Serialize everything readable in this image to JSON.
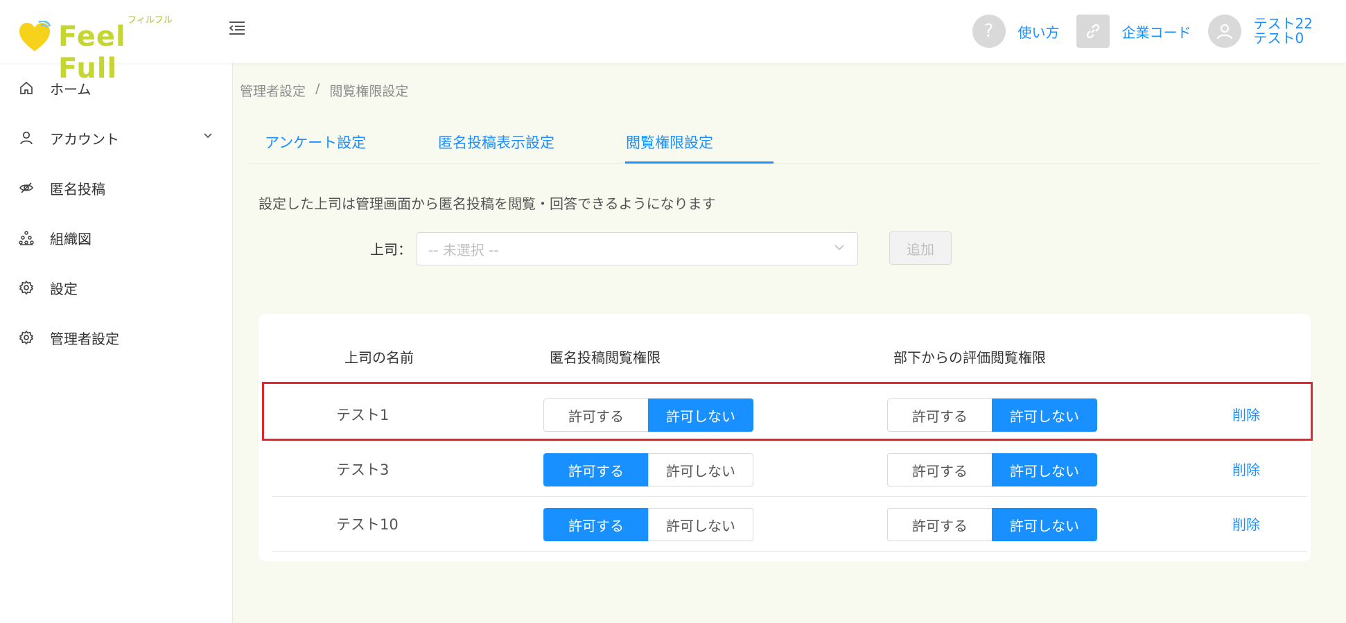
{
  "header": {
    "brand": "Feel Full",
    "brand_kana": "フィルフル",
    "help_label": "使い方",
    "company_code_label": "企業コード",
    "user_line1": "テスト22",
    "user_line2": "テスト0"
  },
  "sidebar": {
    "items": [
      {
        "label": "ホーム",
        "icon": "home-icon"
      },
      {
        "label": "アカウント",
        "icon": "user-icon"
      },
      {
        "label": "匿名投稿",
        "icon": "eye-off-icon"
      },
      {
        "label": "組織図",
        "icon": "org-chart-icon"
      },
      {
        "label": "設定",
        "icon": "gear-icon"
      },
      {
        "label": "管理者設定",
        "icon": "gear-icon"
      }
    ]
  },
  "breadcrumb": {
    "parent": "管理者設定",
    "separator": "/",
    "current": "閲覧権限設定"
  },
  "tabs": [
    {
      "label": "アンケート設定"
    },
    {
      "label": "匿名投稿表示設定"
    },
    {
      "label": "閲覧権限設定"
    }
  ],
  "description": "設定した上司は管理画面から匿名投稿を閲覧・回答できるようになります",
  "form": {
    "supervisor_label": "上司：",
    "select_placeholder": "-- 未選択 --",
    "add_label": "追加"
  },
  "table": {
    "headers": [
      "上司の名前",
      "匿名投稿閲覧権限",
      "部下からの評価閲覧権限"
    ],
    "allow_label": "許可する",
    "deny_label": "許可しない",
    "delete_label": "削除",
    "rows": [
      {
        "name": "テスト1",
        "anon_allowed": false,
        "eval_allowed": false
      },
      {
        "name": "テスト3",
        "anon_allowed": true,
        "eval_allowed": false
      },
      {
        "name": "テスト10",
        "anon_allowed": true,
        "eval_allowed": false
      }
    ]
  },
  "colors": {
    "accent": "#1890ff",
    "brand": "#c5d532",
    "heart": "#f7d21b",
    "highlight": "#e0262e"
  }
}
